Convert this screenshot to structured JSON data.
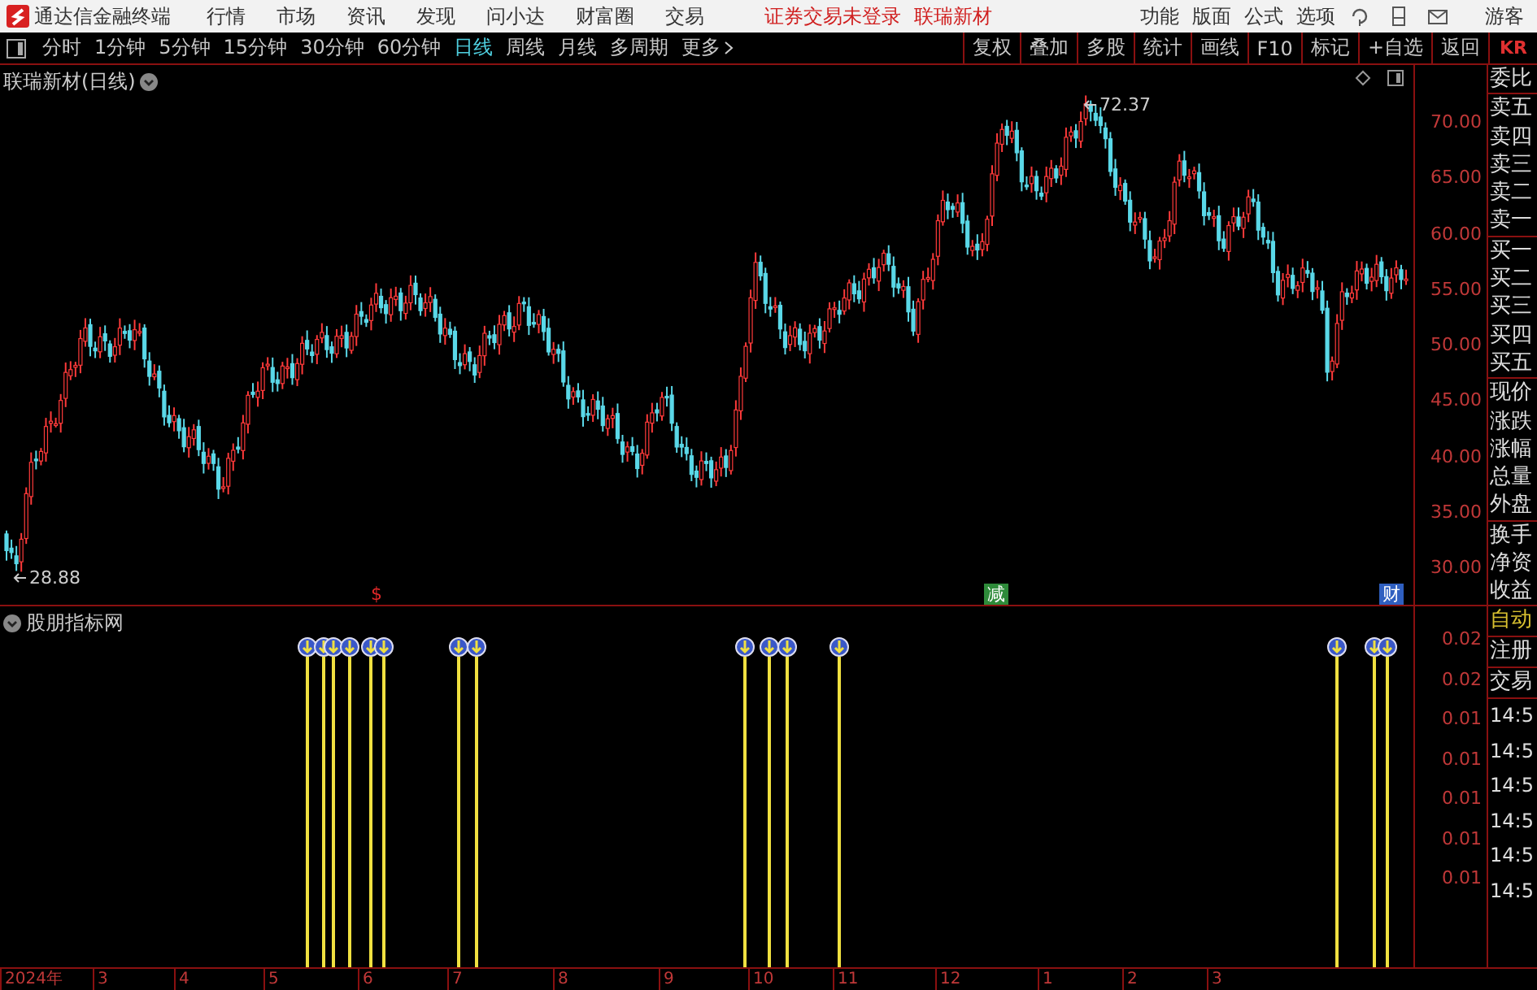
{
  "menu_bar": {
    "app_title": "通达信金融终端",
    "menus": [
      "行情",
      "市场",
      "资讯",
      "发现",
      "问小达",
      "财富圈",
      "交易"
    ],
    "status": [
      "证券交易未登录",
      "联瑞新材"
    ],
    "right_menus": [
      "功能",
      "版面",
      "公式",
      "选项"
    ],
    "user": "游客"
  },
  "toolbar": {
    "periods": [
      {
        "label": "分时",
        "selected": false
      },
      {
        "label": "1分钟",
        "selected": false
      },
      {
        "label": "5分钟",
        "selected": false
      },
      {
        "label": "15分钟",
        "selected": false
      },
      {
        "label": "30分钟",
        "selected": false
      },
      {
        "label": "60分钟",
        "selected": false
      },
      {
        "label": "日线",
        "selected": true
      },
      {
        "label": "周线",
        "selected": false
      },
      {
        "label": "月线",
        "selected": false
      },
      {
        "label": "多周期",
        "selected": false
      }
    ],
    "more": "更多",
    "actions": [
      "复权",
      "叠加",
      "多股",
      "统计",
      "画线",
      "F10",
      "标记",
      "+自选",
      "返回"
    ],
    "badge": "KR"
  },
  "price_chart": {
    "title": "联瑞新材(日线)",
    "high_label": "72.37",
    "low_label": "28.88",
    "y_axis": [
      "70.00",
      "65.00",
      "60.00",
      "55.00",
      "50.00",
      "45.00",
      "40.00",
      "35.00",
      "30.00"
    ],
    "markers": [
      {
        "text": "$",
        "kind": "symbol",
        "color": "#e02828"
      },
      {
        "text": "减",
        "kind": "tag",
        "color": "#2e8b3a"
      },
      {
        "text": "财",
        "kind": "tag",
        "color": "#2f5fc0"
      }
    ]
  },
  "indicator": {
    "title": "股朋指标网",
    "y_axis": [
      "0.02",
      "0.02",
      "0.01",
      "0.01",
      "0.01",
      "0.01",
      "0.01"
    ]
  },
  "side_panel": {
    "quote_groups": [
      [
        "委比"
      ],
      [
        "卖五",
        "卖四",
        "卖三",
        "卖二",
        "卖一"
      ],
      [
        "买一",
        "买二",
        "买三",
        "买四",
        "买五"
      ],
      [
        "现价",
        "涨跌",
        "涨幅",
        "总量",
        "外盘"
      ],
      [
        "换手",
        "净资",
        "收益"
      ]
    ],
    "modes": [
      {
        "label": "自动",
        "selected": true
      },
      {
        "label": "注册",
        "selected": false
      },
      {
        "label": "交易",
        "selected": false
      }
    ],
    "times": [
      "14:5",
      "14:5",
      "14:5",
      "14:5",
      "14:5",
      "14:5"
    ]
  },
  "date_axis": [
    "2024年",
    "3",
    "4",
    "5",
    "6",
    "7",
    "8",
    "9",
    "10",
    "11",
    "12",
    "1",
    "2",
    "3"
  ]
}
